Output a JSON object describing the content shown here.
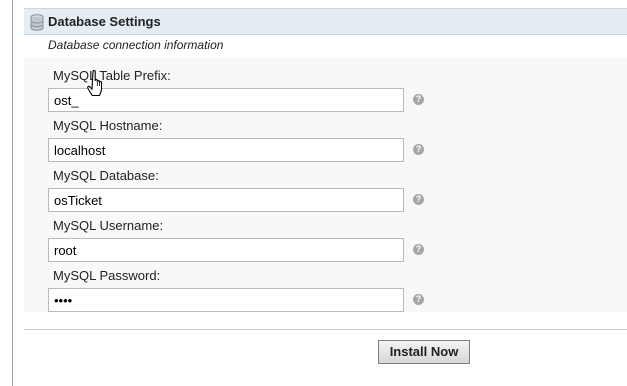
{
  "section": {
    "title": "Database Settings",
    "description": "Database connection information",
    "icon": "database-icon"
  },
  "fields": [
    {
      "label": "MySQL Table Prefix:",
      "value": "ost_"
    },
    {
      "label": "MySQL Hostname:",
      "value": "localhost"
    },
    {
      "label": "MySQL Database:",
      "value": "osTicket"
    },
    {
      "label": "MySQL Username:",
      "value": "root"
    },
    {
      "label": "MySQL Password:",
      "value": "••••"
    }
  ],
  "help_icon": {
    "glyph": "?",
    "icon": "help-icon"
  },
  "install_button": {
    "label": "Install Now"
  },
  "cursor": {
    "icon": "hand-pointer-icon"
  },
  "colors": {
    "header_bg": "#e4ecf4",
    "fields_bg": "#f7f8f9",
    "help_icon": "#a6a6a6"
  }
}
